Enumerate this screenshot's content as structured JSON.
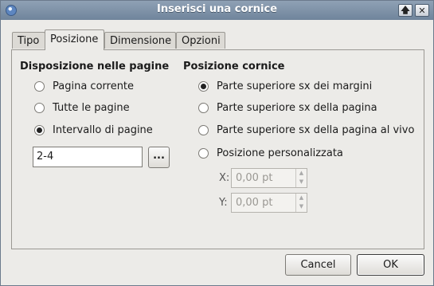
{
  "window": {
    "title": "Inserisci una cornice"
  },
  "tabs": [
    {
      "label": "Tipo"
    },
    {
      "label": "Posizione"
    },
    {
      "label": "Dimensione"
    },
    {
      "label": "Opzioni"
    }
  ],
  "placement": {
    "heading": "Disposizione nelle pagine",
    "options": [
      {
        "label": "Pagina corrente",
        "checked": false
      },
      {
        "label": "Tutte le pagine",
        "checked": false
      },
      {
        "label": "Intervallo di pagine",
        "checked": true
      }
    ],
    "range_value": "2-4",
    "browse_label": "..."
  },
  "position": {
    "heading": "Posizione cornice",
    "options": [
      {
        "label": "Parte superiore sx dei margini",
        "checked": true
      },
      {
        "label": "Parte superiore sx della pagina",
        "checked": false
      },
      {
        "label": "Parte superiore sx della pagina al vivo",
        "checked": false
      },
      {
        "label": "Posizione personalizzata",
        "checked": false
      }
    ],
    "x_label": "X:",
    "x_value": "0,00 pt",
    "y_label": "Y:",
    "y_value": "0,00 pt"
  },
  "buttons": {
    "cancel": "Cancel",
    "ok": "OK"
  }
}
